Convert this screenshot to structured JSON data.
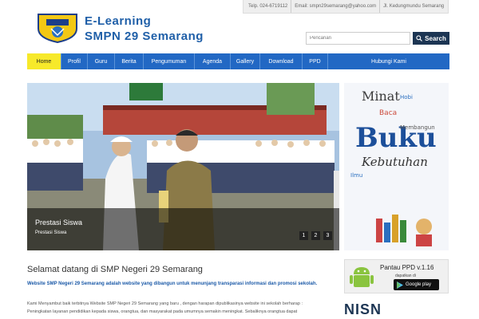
{
  "site": {
    "title_line1": "E-Learning",
    "title_line2": "SMPN 29 Semarang"
  },
  "contact": {
    "phone": "Telp. 024-6719112",
    "email": "Email: smpn29semarang@yahoo.com",
    "address": "Jl. Kedungmundu Semarang"
  },
  "search": {
    "placeholder": "Pencarian",
    "button": "Search"
  },
  "nav": [
    "Home",
    "Profil",
    "Guru",
    "Berita",
    "Pengumuman",
    "Agenda",
    "Gallery",
    "Download",
    "PPD",
    "Hubungi Kami"
  ],
  "slider": {
    "title": "Prestasi Siswa",
    "subtitle": "Prestasi Siswa",
    "pages": [
      "1",
      "2",
      "3"
    ]
  },
  "banner": {
    "words": [
      "Minat",
      "Baca",
      "Buku",
      "Kebutuhan",
      "Membangun",
      "Hobi",
      "Ilmu"
    ]
  },
  "content": {
    "heading": "Selamat datang di SMP Negeri 29 Semarang",
    "intro": "Website SMP Negeri 29 Semarang adalah website yang dibangun untuk menunjang transparasi informasi dan promosi sekolah.",
    "para1": "Kami Menyambut baik terbitnya Website SMP Negeri 29 Semarang yang baru , dengan harapan dipublikasinya website ini sekolah berharap :",
    "para2": "Peningkatan layanan pendidikan kepada siswa, orangtua, dan masyarakat pada umumnya semakin meningkat. Sebaliknya orangtua dapat"
  },
  "ppd": {
    "title": "Pantau PPD v.1.16",
    "sub": "dapatkan di",
    "store": "Google play"
  },
  "nisn": "NISN"
}
